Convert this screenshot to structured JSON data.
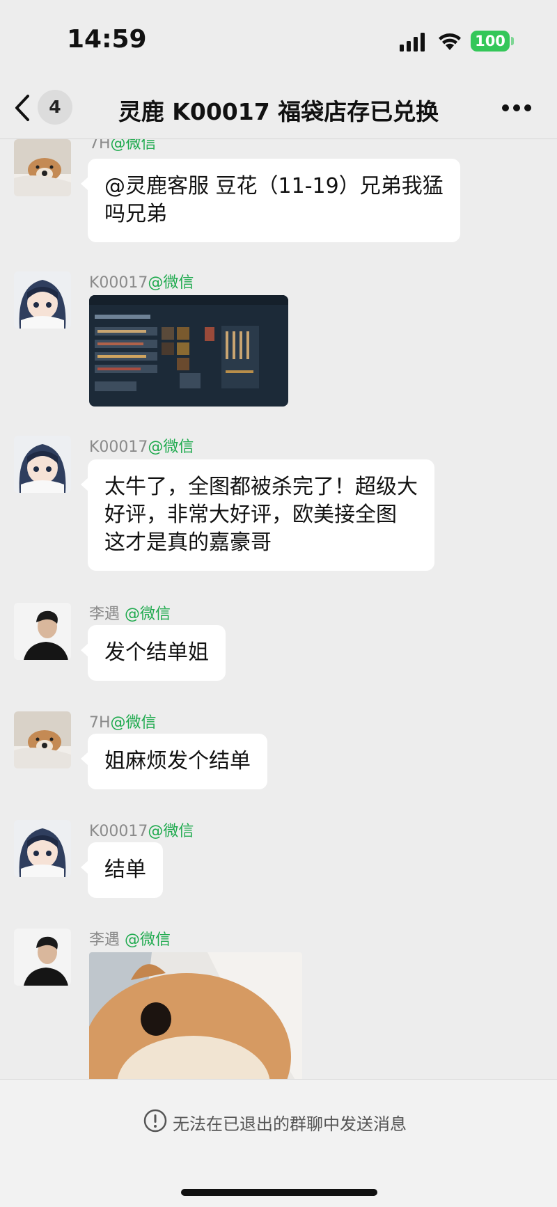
{
  "status_bar": {
    "time": "14:59",
    "battery": "100"
  },
  "nav": {
    "unread_count": "4",
    "title": "灵鹿 K00017 福袋店存已兑换"
  },
  "messages": [
    {
      "sender_name": "7H",
      "sender_tag": "@微信",
      "lines": [
        "@灵鹿客服 豆花（11-19）兄弟我猛",
        "吗兄弟"
      ],
      "avatar": "dog-avatar"
    },
    {
      "sender_name": "K00017",
      "sender_tag": "@微信",
      "image": "game-inventory-screenshot",
      "avatar": "anime-girl-avatar"
    },
    {
      "sender_name": "K00017",
      "sender_tag": "@微信",
      "lines": [
        "太牛了，全图都被杀完了！超级大",
        "好评，非常大好评，欧美接全图",
        "这才是真的嘉豪哥"
      ],
      "avatar": "anime-girl-avatar"
    },
    {
      "sender_name": "李遇 ",
      "sender_tag": "@微信",
      "lines": [
        "发个结单姐"
      ],
      "avatar": "man-portrait-avatar"
    },
    {
      "sender_name": "7H",
      "sender_tag": "@微信",
      "lines": [
        "姐麻烦发个结单"
      ],
      "avatar": "dog-avatar"
    },
    {
      "sender_name": "K00017",
      "sender_tag": "@微信",
      "lines": [
        "结单"
      ],
      "avatar": "anime-girl-avatar"
    },
    {
      "sender_name": "李遇 ",
      "sender_tag": "@微信",
      "image": "shiba-dog-photo",
      "avatar": "man-portrait-avatar"
    }
  ],
  "footer": {
    "notice": "无法在已退出的群聊中发送消息"
  },
  "colors": {
    "background": "#EDEDED",
    "bubble": "#FFFFFF",
    "tag_green": "#1FAA4E",
    "battery_green": "#34C759"
  }
}
